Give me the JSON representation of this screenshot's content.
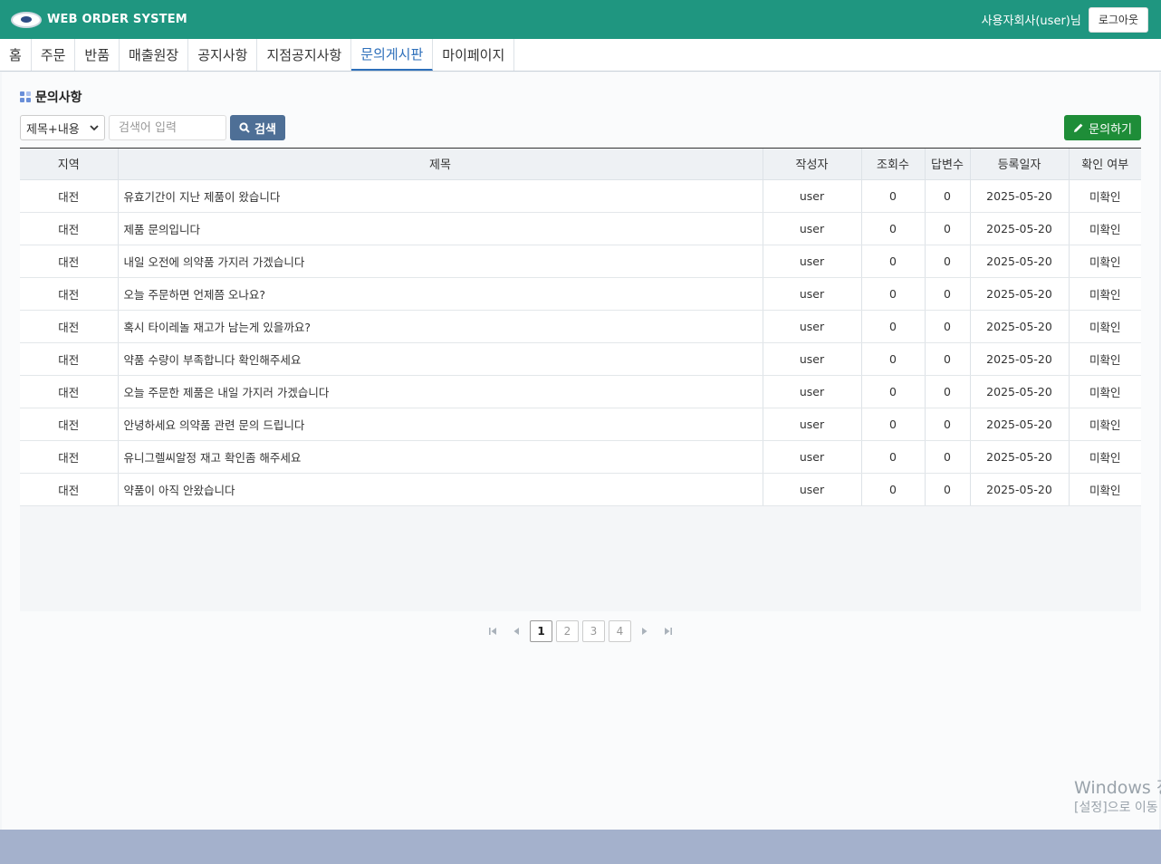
{
  "header": {
    "brand": "WEB ORDER SYSTEM",
    "user_text": "사용자회사(user)님",
    "logout_label": "로그아웃"
  },
  "nav": {
    "items": [
      "홈",
      "주문",
      "반품",
      "매출원장",
      "공지사항",
      "지점공지사항",
      "문의게시판",
      "마이페이지"
    ],
    "active": "문의게시판"
  },
  "page": {
    "title": "문의사항"
  },
  "search": {
    "select_value": "제목+내용",
    "placeholder": "검색어 입력",
    "button_label": "검색"
  },
  "ask_button_label": "문의하기",
  "table": {
    "headers": [
      "지역",
      "제목",
      "작성자",
      "조회수",
      "답변수",
      "등록일자",
      "확인 여부"
    ],
    "rows": [
      {
        "region": "대전",
        "title": "유효기간이 지난 제품이 왔습니다",
        "author": "user",
        "views": "0",
        "answers": "0",
        "date": "2025-05-20",
        "status": "미확인"
      },
      {
        "region": "대전",
        "title": "제품 문의입니다",
        "author": "user",
        "views": "0",
        "answers": "0",
        "date": "2025-05-20",
        "status": "미확인"
      },
      {
        "region": "대전",
        "title": "내일 오전에 의약품 가지러 가겠습니다",
        "author": "user",
        "views": "0",
        "answers": "0",
        "date": "2025-05-20",
        "status": "미확인"
      },
      {
        "region": "대전",
        "title": "오늘 주문하면 언제쯤 오나요?",
        "author": "user",
        "views": "0",
        "answers": "0",
        "date": "2025-05-20",
        "status": "미확인"
      },
      {
        "region": "대전",
        "title": "혹시 타이레놀 재고가 남는게 있을까요?",
        "author": "user",
        "views": "0",
        "answers": "0",
        "date": "2025-05-20",
        "status": "미확인"
      },
      {
        "region": "대전",
        "title": "약품 수량이 부족합니다 확인해주세요",
        "author": "user",
        "views": "0",
        "answers": "0",
        "date": "2025-05-20",
        "status": "미확인"
      },
      {
        "region": "대전",
        "title": "오늘 주문한 제품은 내일 가지러 가겠습니다",
        "author": "user",
        "views": "0",
        "answers": "0",
        "date": "2025-05-20",
        "status": "미확인"
      },
      {
        "region": "대전",
        "title": "안녕하세요 의약품 관련 문의 드립니다",
        "author": "user",
        "views": "0",
        "answers": "0",
        "date": "2025-05-20",
        "status": "미확인"
      },
      {
        "region": "대전",
        "title": "유니그렐씨알정 재고 확인좀 해주세요",
        "author": "user",
        "views": "0",
        "answers": "0",
        "date": "2025-05-20",
        "status": "미확인"
      },
      {
        "region": "대전",
        "title": "약품이 아직 안왔습니다",
        "author": "user",
        "views": "0",
        "answers": "0",
        "date": "2025-05-20",
        "status": "미확인"
      }
    ]
  },
  "pagination": {
    "pages": [
      "1",
      "2",
      "3",
      "4"
    ],
    "current": "1"
  },
  "watermark": {
    "line1": "Windows 정",
    "line2": "[설정]으로 이동"
  }
}
